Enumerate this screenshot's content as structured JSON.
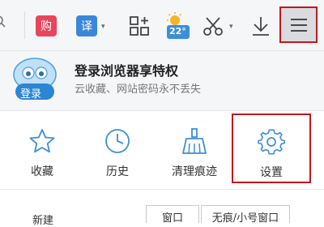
{
  "toolbar": {
    "shop_badge": "购",
    "translate_badge": "译",
    "weather_temp": "22°",
    "caret": "▾"
  },
  "login": {
    "avatar_button": "登录",
    "title": "登录浏览器享特权",
    "subtitle": "云收藏、网站密码永不丢失"
  },
  "tiles": [
    {
      "label": "收藏",
      "icon": "star-icon"
    },
    {
      "label": "历史",
      "icon": "clock-icon"
    },
    {
      "label": "清理痕迹",
      "icon": "broom-icon"
    },
    {
      "label": "设置",
      "icon": "gear-icon"
    }
  ],
  "bottom": {
    "new_label": "新建",
    "window_label": "窗口",
    "incognito_label": "无痕/小号窗口"
  },
  "colors": {
    "accent": "#3e8fd6",
    "highlight": "#c0171c",
    "shop": "#e8465a",
    "translate": "#3a87d9"
  }
}
